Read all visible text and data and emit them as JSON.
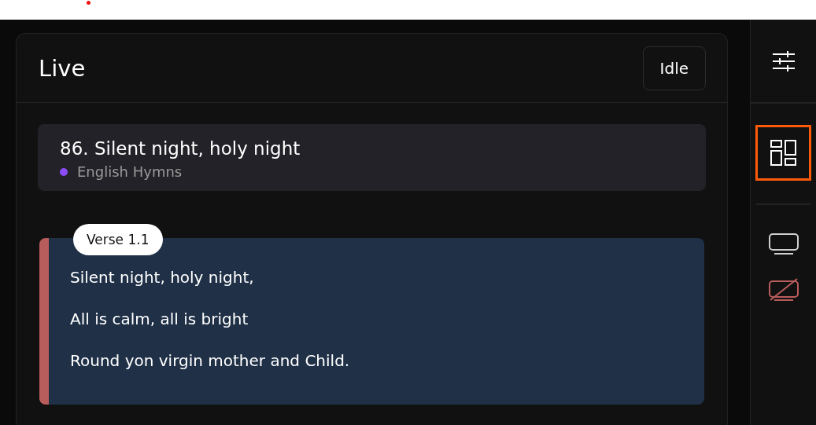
{
  "panel": {
    "title": "Live",
    "status_button": "Idle"
  },
  "song": {
    "title": "86. Silent night, holy night",
    "collection": "English Hymns",
    "color": "#8b4cf7"
  },
  "slide": {
    "label": "Verse 1.1",
    "color": "#b95c5c",
    "lines": [
      "Silent night, holy night,",
      "All is calm, all is bright",
      "Round yon virgin mother and Child."
    ]
  },
  "sidebar": {
    "tools": [
      {
        "kind": "sliders",
        "selected": false
      },
      {
        "kind": "layout",
        "selected": true
      },
      {
        "kind": "monitor",
        "selected": false
      },
      {
        "kind": "monitor-off",
        "selected": false
      }
    ]
  }
}
